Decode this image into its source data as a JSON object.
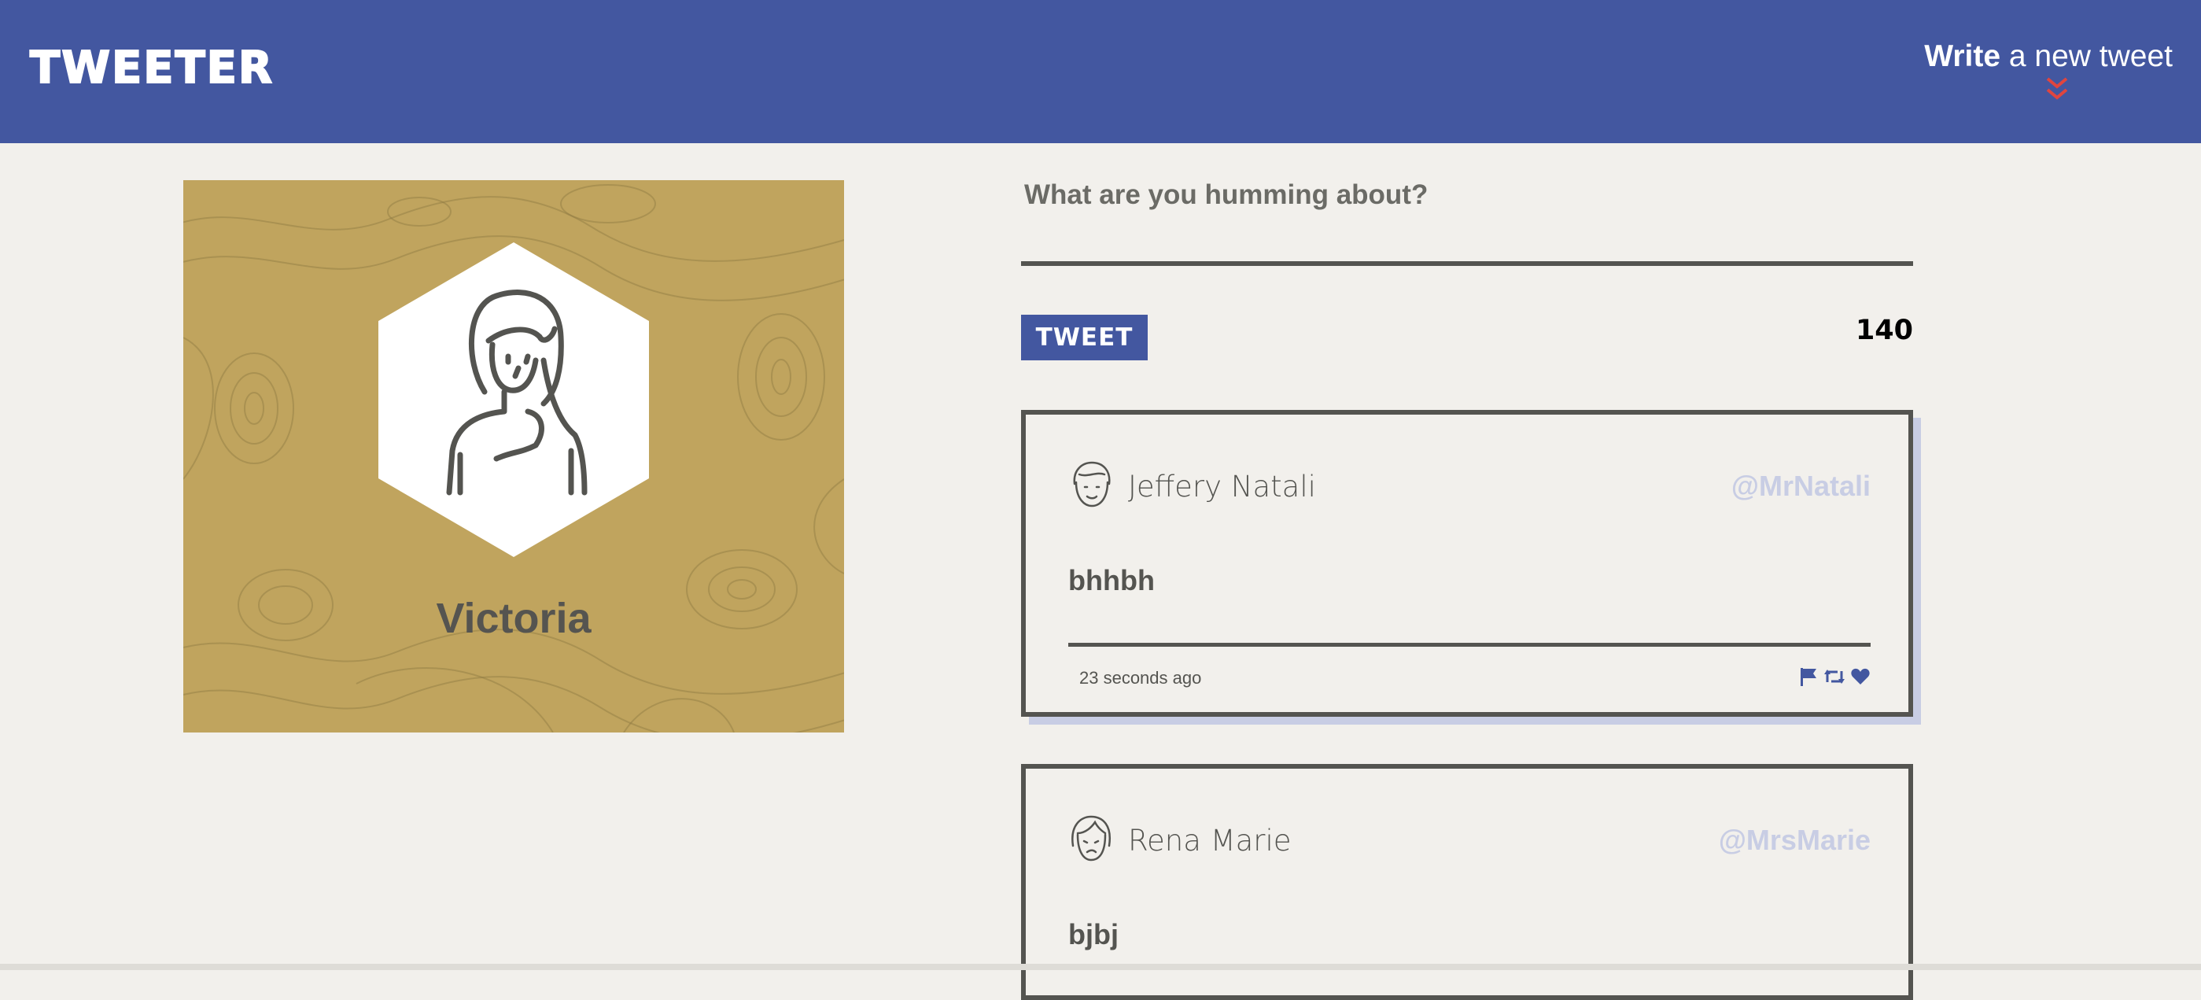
{
  "nav": {
    "brand": "TWEETER",
    "compose_strong": "Write",
    "compose_rest": " a new tweet"
  },
  "profile": {
    "name": "Victoria"
  },
  "compose": {
    "placeholder": "What are you humming about?",
    "button_label": "TWEET",
    "counter": "140"
  },
  "tweets": [
    {
      "name": "Jeffery Natali",
      "handle": "@MrNatali",
      "body": "bhhbh",
      "time": "23 seconds ago"
    },
    {
      "name": "Rena Marie",
      "handle": "@MrsMarie",
      "body": "bjbj"
    }
  ],
  "colors": {
    "nav_background": "#4357a0",
    "page_background": "#f2f0ec",
    "profile_background": "#c0a45e",
    "text_dark": "#545450",
    "handle": "#c8cde4",
    "chevron": "#e0453f"
  },
  "icons": [
    "flag-icon",
    "retweet-icon",
    "heart-icon",
    "chevron-double-down-icon",
    "user-avatar-icon"
  ]
}
